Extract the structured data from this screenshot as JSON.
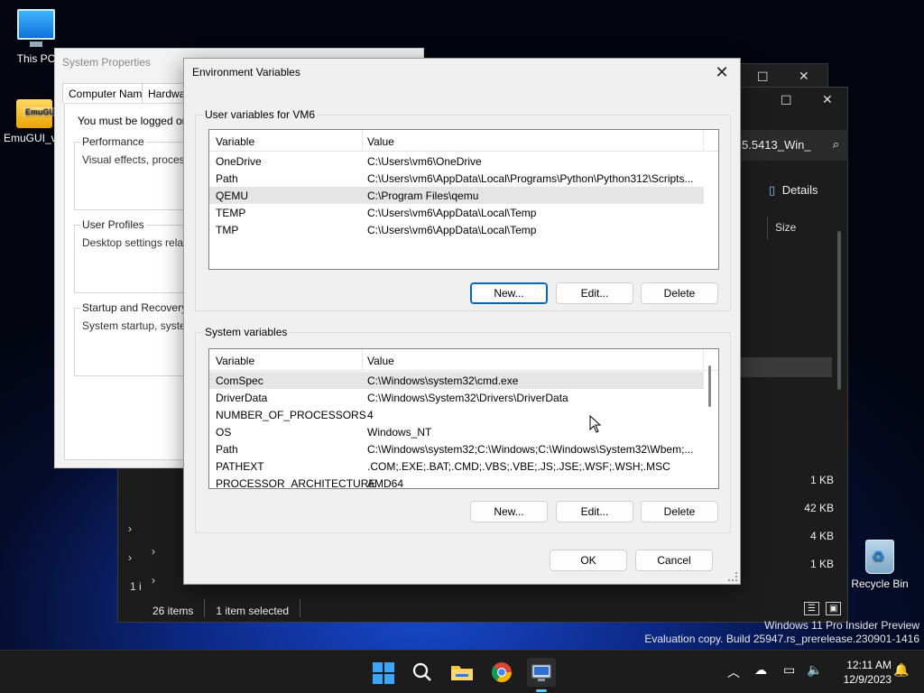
{
  "desktop": {
    "icons": [
      {
        "label": "This PC"
      },
      {
        "label": "EmuGUI_v1",
        "tag": "EmuGUI"
      },
      {
        "label": "Recycle Bin"
      }
    ]
  },
  "explorer": {
    "search_text": "5.5413_Win_",
    "details_label": "Details",
    "size_header": "Size",
    "sizes": [
      "1 KB",
      "42 KB",
      "4 KB",
      "1 KB"
    ],
    "status_items": "26 items",
    "status_selected": "1 item selected",
    "left_stub": "1 i"
  },
  "system_properties": {
    "title": "System Properties",
    "tabs": [
      "Computer Name",
      "Hardware"
    ],
    "logon_notice": "You must be logged on a",
    "groups": [
      {
        "title": "Performance",
        "text": "Visual effects, processor"
      },
      {
        "title": "User Profiles",
        "text": "Desktop settings related"
      },
      {
        "title": "Startup and Recovery",
        "text": "System startup, system f"
      }
    ]
  },
  "env_dialog": {
    "title": "Environment Variables",
    "user_section_title": "User variables for VM6",
    "system_section_title": "System variables",
    "col_variable": "Variable",
    "col_value": "Value",
    "user_vars": [
      {
        "name": "OneDrive",
        "value": "C:\\Users\\vm6\\OneDrive"
      },
      {
        "name": "Path",
        "value": "C:\\Users\\vm6\\AppData\\Local\\Programs\\Python\\Python312\\Scripts..."
      },
      {
        "name": "QEMU",
        "value": "C:\\Program Files\\qemu"
      },
      {
        "name": "TEMP",
        "value": "C:\\Users\\vm6\\AppData\\Local\\Temp"
      },
      {
        "name": "TMP",
        "value": "C:\\Users\\vm6\\AppData\\Local\\Temp"
      }
    ],
    "system_vars": [
      {
        "name": "ComSpec",
        "value": "C:\\Windows\\system32\\cmd.exe"
      },
      {
        "name": "DriverData",
        "value": "C:\\Windows\\System32\\Drivers\\DriverData"
      },
      {
        "name": "NUMBER_OF_PROCESSORS",
        "value": "4"
      },
      {
        "name": "OS",
        "value": "Windows_NT"
      },
      {
        "name": "Path",
        "value": "C:\\Windows\\system32;C:\\Windows;C:\\Windows\\System32\\Wbem;..."
      },
      {
        "name": "PATHEXT",
        "value": ".COM;.EXE;.BAT;.CMD;.VBS;.VBE;.JS;.JSE;.WSF;.WSH;.MSC"
      },
      {
        "name": "PROCESSOR_ARCHITECTURE",
        "value": "AMD64"
      }
    ],
    "buttons": {
      "new": "New...",
      "edit": "Edit...",
      "delete": "Delete",
      "ok": "OK",
      "cancel": "Cancel"
    }
  },
  "watermark": {
    "line1": "Windows 11 Pro Insider Preview",
    "line2": "Evaluation copy. Build 25947.rs_prerelease.230901-1416"
  },
  "taskbar": {
    "time": "12:11 AM",
    "date": "12/9/2023"
  }
}
